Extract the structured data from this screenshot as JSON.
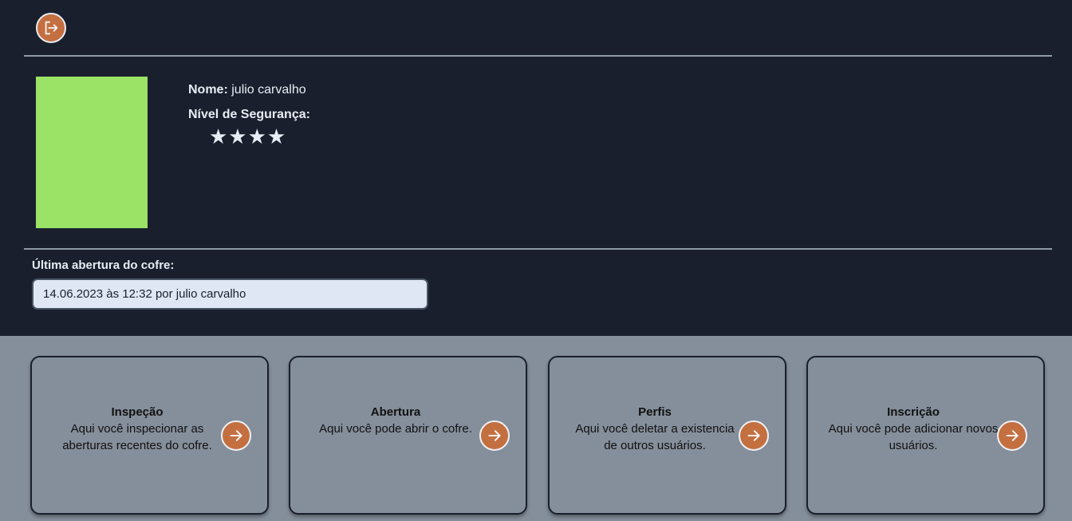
{
  "header": {
    "logout_icon": "logout-icon",
    "accent_color": "#c46f40"
  },
  "profile": {
    "name_label": "Nome:",
    "name_value": "julio carvalho",
    "security_label": "Nível de Segurança:",
    "security_stars": "★★★★",
    "security_level": 4,
    "avatar_color": "#9be366"
  },
  "last_opening": {
    "label": "Última abertura do cofre:",
    "value": "14.06.2023 às 12:32 por julio carvalho"
  },
  "cards": [
    {
      "title": "Inspeção",
      "description": "Aqui você inspecionar as aberturas recentes do cofre.",
      "icon": "arrow-right-icon"
    },
    {
      "title": "Abertura",
      "description": "Aqui você pode abrir o cofre.",
      "icon": "arrow-right-icon"
    },
    {
      "title": "Perfis",
      "description": "Aqui você deletar a existencia de outros usuários.",
      "icon": "arrow-right-icon"
    },
    {
      "title": "Inscrição",
      "description": "Aqui você pode adicionar novos usuários.",
      "icon": "arrow-right-icon"
    }
  ]
}
